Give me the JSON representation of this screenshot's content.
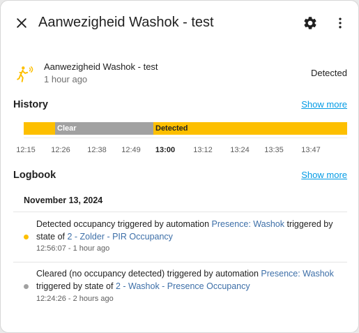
{
  "header": {
    "title": "Aanwezigheid Washok - test",
    "close_icon": "close-icon",
    "settings_icon": "gear-icon",
    "menu_icon": "more-vert-icon"
  },
  "entity": {
    "name": "Aanwezigheid Washok - test",
    "last_changed": "1 hour ago",
    "state": "Detected",
    "icon": "motion-sensor-icon",
    "icon_color": "#fdbf00"
  },
  "history": {
    "title": "History",
    "show_more": "Show more",
    "segments": [
      {
        "label": "",
        "state": "detected",
        "color": "#fdbf00"
      },
      {
        "label": "Clear",
        "state": "clear",
        "color": "#a1a1a1"
      },
      {
        "label": "Detected",
        "state": "detected",
        "color": "#fdbf00"
      }
    ],
    "ticks": [
      "12:15",
      "12:26",
      "12:38",
      "12:49",
      "13:00",
      "13:12",
      "13:24",
      "13:35",
      "13:47"
    ],
    "bold_tick": "13:00"
  },
  "logbook": {
    "title": "Logbook",
    "show_more": "Show more",
    "date": "November 13, 2024",
    "entries": [
      {
        "text_before": "Detected occupancy triggered by automation ",
        "link1": "Presence: Washok",
        "text_middle": " triggered by state of ",
        "link2": "2 - Zolder - PIR Occupancy",
        "time": "12:56:07 - 1 hour ago",
        "dot_color": "#fdbf00"
      },
      {
        "text_before": "Cleared (no occupancy detected) triggered by automation ",
        "link1": "Presence: Washok",
        "text_middle": " triggered by state of ",
        "link2": "2 - Washok - Presence Occupancy",
        "time": "12:24:26 - 2 hours ago",
        "dot_color": "#a1a1a1"
      }
    ]
  }
}
